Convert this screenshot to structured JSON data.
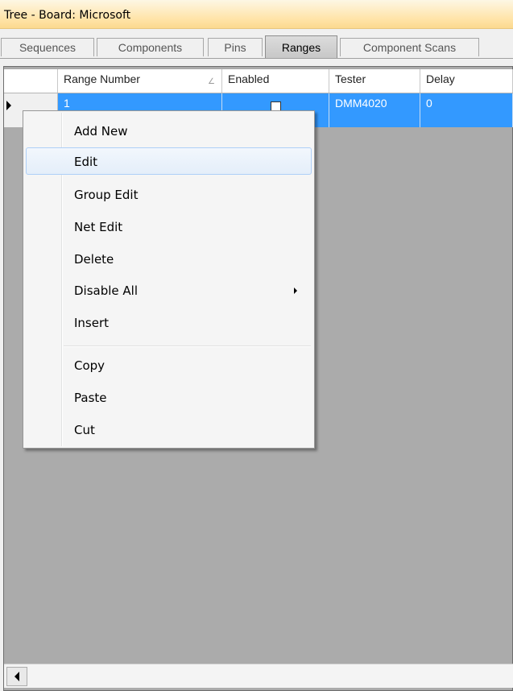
{
  "window": {
    "title": "Tree - Board: Microsoft"
  },
  "tabs": [
    {
      "label": "Sequences",
      "active": false
    },
    {
      "label": "Components",
      "active": false
    },
    {
      "label": "Pins",
      "active": false
    },
    {
      "label": "Ranges",
      "active": true
    },
    {
      "label": "Component Scans",
      "active": false
    }
  ],
  "grid": {
    "columns": [
      "Range Number",
      "Enabled",
      "Tester",
      "Delay"
    ],
    "sort_indicator": "∠",
    "rows": [
      {
        "range_number": "1",
        "enabled": true,
        "tester": "DMM4020",
        "delay": "0",
        "selected": true
      }
    ]
  },
  "context_menu": {
    "items": [
      {
        "label": "Add New"
      },
      {
        "label": "Edit",
        "hover": true
      },
      {
        "label": "Group Edit"
      },
      {
        "label": "Net Edit"
      },
      {
        "label": "Delete"
      },
      {
        "label": "Disable All",
        "submenu": true
      },
      {
        "label": "Insert"
      },
      {
        "label": "Copy"
      },
      {
        "label": "Paste"
      },
      {
        "label": "Cut"
      }
    ]
  },
  "colors": {
    "title_bar": "#ffe3a6",
    "selection": "#3399ff",
    "grid_background": "#ababab",
    "menu_hover_border": "#aecff7"
  },
  "icons": [
    "row-selector-arrow-icon",
    "submenu-arrow-icon",
    "scroll-left-arrow-icon",
    "checkbox-checked-icon"
  ]
}
